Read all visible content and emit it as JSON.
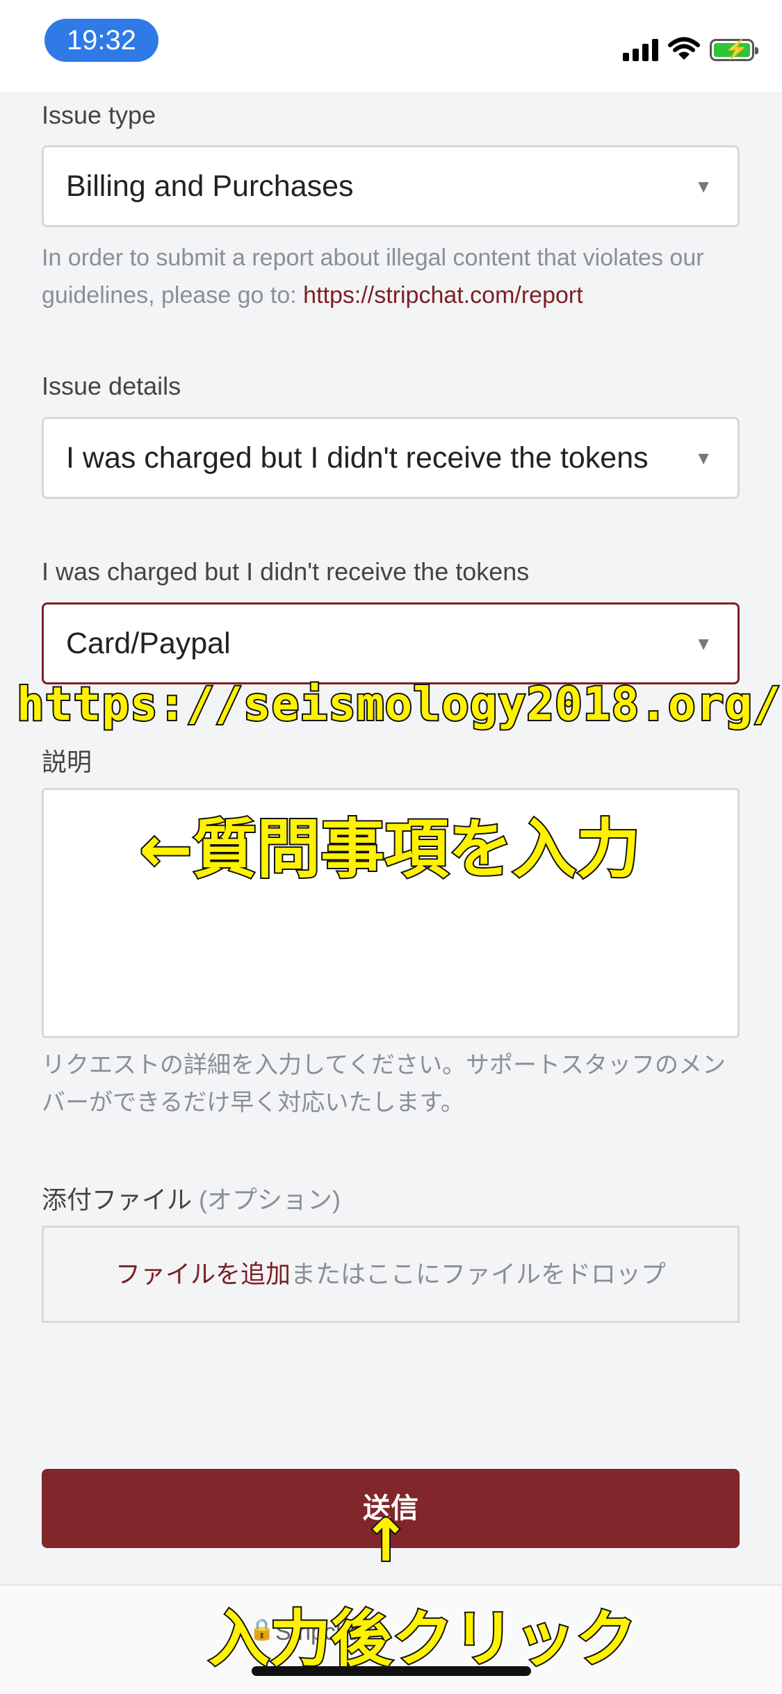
{
  "status_bar": {
    "time": "19:32"
  },
  "form": {
    "issue_type": {
      "label": "Issue type",
      "value": "Billing and Purchases",
      "arrow": "▼"
    },
    "report_hint": {
      "text": "In order to submit a report about illegal content that violates our guidelines, please go to: ",
      "link": "https://stripchat.com/report"
    },
    "issue_details": {
      "label": "Issue details",
      "value": "I was charged but I didn't receive the tokens",
      "arrow": "▼"
    },
    "payment_method": {
      "label": "I was charged but I didn't receive the tokens",
      "value": "Card/Paypal",
      "arrow": "▼"
    },
    "description": {
      "label": "説明",
      "value": "",
      "hint": "リクエストの詳細を入力してください。サポートスタッフのメンバーができるだけ早く対応いたします。"
    },
    "attachments": {
      "label": "添付ファイル",
      "optional": "(オプション)",
      "add_link": "ファイルを追加",
      "drop_text": "またはここにファイルをドロップ"
    },
    "submit_label": "送信"
  },
  "footer": {
    "text": "Stripchat"
  },
  "annotations": {
    "url": "https://seismology2018.org/",
    "input_hint": "←質問事項を入力",
    "arrow_up": "↑",
    "click_hint": "入力後クリック"
  },
  "colors": {
    "accent": "#81262b",
    "link": "#7d1f23",
    "time_pill": "#2f7ae6",
    "annotation": "#fff200"
  }
}
